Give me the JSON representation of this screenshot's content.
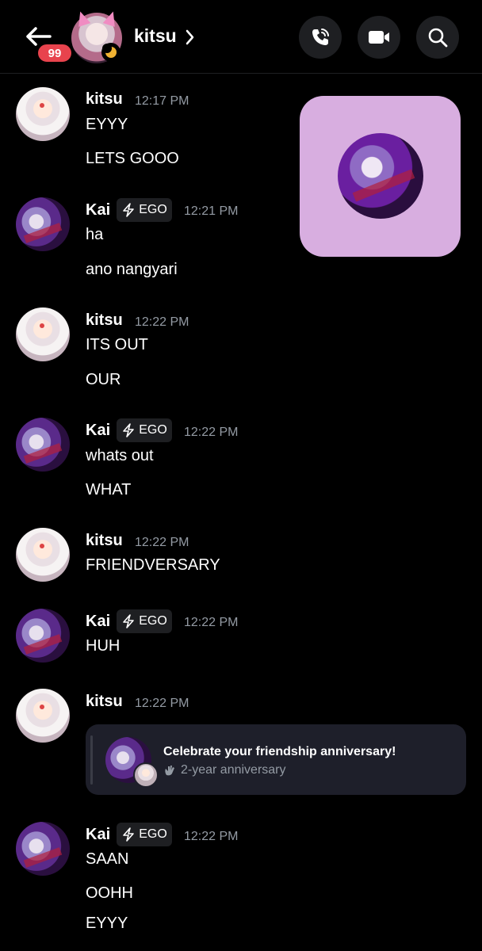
{
  "header": {
    "unread_count": "99",
    "channel_name": "kitsu"
  },
  "messages": [
    {
      "author": "kitsu",
      "time": "12:17 PM",
      "lines": [
        "EYYY",
        "LETS GOOO"
      ]
    },
    {
      "author": "Kai",
      "tag": "EGO",
      "time": "12:21 PM",
      "lines": [
        "ha",
        "ano nangyari"
      ]
    },
    {
      "author": "kitsu",
      "time": "12:22 PM",
      "lines": [
        "ITS OUT",
        "OUR"
      ]
    },
    {
      "author": "Kai",
      "tag": "EGO",
      "time": "12:22 PM",
      "lines": [
        "whats out",
        "WHAT"
      ]
    },
    {
      "author": "kitsu",
      "time": "12:22 PM",
      "lines": [
        "FRIENDVERSARY"
      ]
    },
    {
      "author": "Kai",
      "tag": "EGO",
      "time": "12:22 PM",
      "lines": [
        "HUH"
      ]
    },
    {
      "author": "kitsu",
      "time": "12:22 PM",
      "lines": []
    },
    {
      "author": "Kai",
      "tag": "EGO",
      "time": "12:22 PM",
      "lines": [
        "SAAN",
        "OOHH",
        "EYYY"
      ]
    }
  ],
  "anniversary_card": {
    "title": "Celebrate your friendship anniversary!",
    "subtitle": "2-year anniversary"
  },
  "colors": {
    "background": "#000000",
    "surface": "#1e1f22",
    "muted_text": "#949ba4",
    "badge_red": "#e8434d",
    "sticker_bg": "#d8aee0",
    "status_idle": "#f0b232"
  },
  "icons": [
    "back-arrow-icon",
    "chevron-right-icon",
    "voice-call-icon",
    "video-call-icon",
    "search-icon",
    "lightning-icon",
    "wave-hand-icon",
    "idle-moon-icon"
  ]
}
